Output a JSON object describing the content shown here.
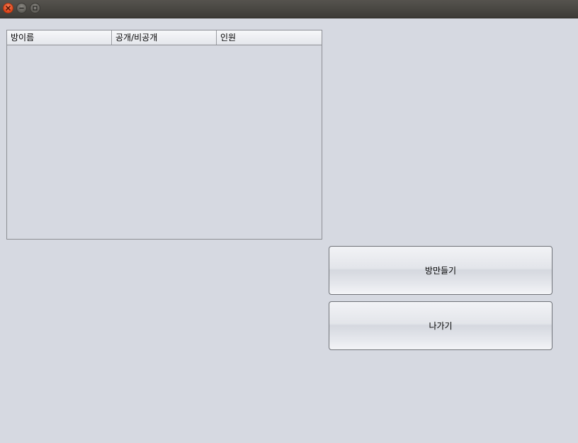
{
  "titlebar": {
    "buttons": [
      {
        "name": "close",
        "icon": "close-icon",
        "color": "#e0451a"
      },
      {
        "name": "minimize",
        "icon": "minimize-icon",
        "color": "#5f5d58"
      },
      {
        "name": "maximize",
        "icon": "maximize-icon",
        "color": "#5f5d58"
      }
    ]
  },
  "room_table": {
    "columns": [
      "방이름",
      "공개/비공개",
      "인원"
    ],
    "rows": []
  },
  "actions": {
    "create_room_label": "방만들기",
    "exit_label": "나가기"
  }
}
